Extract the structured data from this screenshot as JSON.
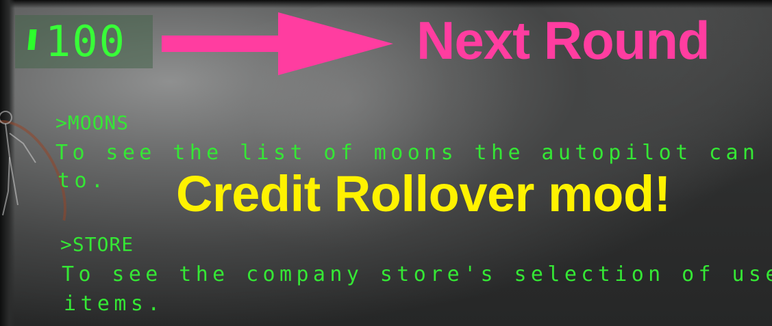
{
  "hud": {
    "credits_value": "100",
    "credits_icon": "credits-icon"
  },
  "annotations": {
    "next_round": "Next Round",
    "mod_title": "Credit Rollover mod!",
    "arrow_icon": "arrow-right-icon",
    "arrow_color": "#ff3da0",
    "mod_title_color": "#fff200"
  },
  "terminal": {
    "text_color": "#35e735",
    "moons_command": ">MOONS",
    "moons_desc_line1": "To see the list of moons the autopilot can rout",
    "moons_desc_line2": "to.",
    "store_command": ">STORE",
    "store_desc_line1": "To see the company store's selection of useful",
    "store_desc_line2": "items."
  }
}
